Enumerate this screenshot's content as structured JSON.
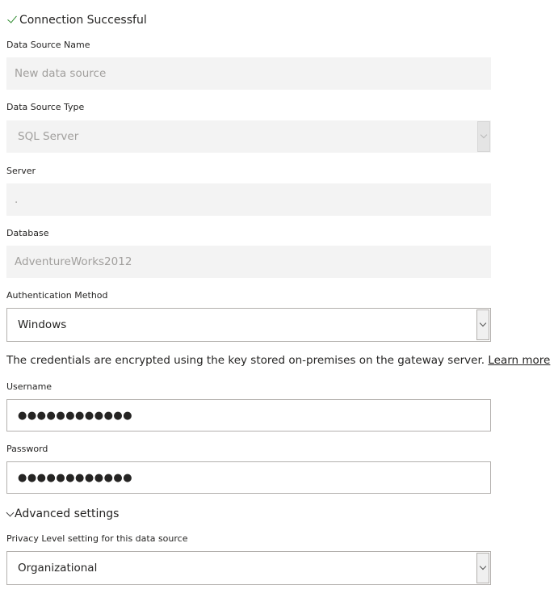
{
  "status": {
    "text": "Connection Successful",
    "icon": "check-icon"
  },
  "fields": {
    "data_source_name": {
      "label": "Data Source Name",
      "value": "New data source"
    },
    "data_source_type": {
      "label": "Data Source Type",
      "value": "SQL Server"
    },
    "server": {
      "label": "Server",
      "value": "."
    },
    "database": {
      "label": "Database",
      "value": "AdventureWorks2012"
    },
    "authentication_method": {
      "label": "Authentication Method",
      "value": "Windows"
    },
    "username": {
      "label": "Username",
      "value": "●●●●●●●●●●●●"
    },
    "password": {
      "label": "Password",
      "value": "●●●●●●●●●●●●"
    },
    "privacy_level": {
      "label": "Privacy Level setting for this data source",
      "value": "Organizational"
    }
  },
  "credentials_info": {
    "text": "The credentials are encrypted using the key stored on-premises on the gateway server.",
    "link": "Learn more"
  },
  "advanced_settings": {
    "label": "Advanced settings"
  },
  "colors": {
    "success_check": "#2e8b2e",
    "disabled_bg": "#f3f3f3",
    "disabled_text": "#a19f9d",
    "border": "#b3b0ad"
  }
}
